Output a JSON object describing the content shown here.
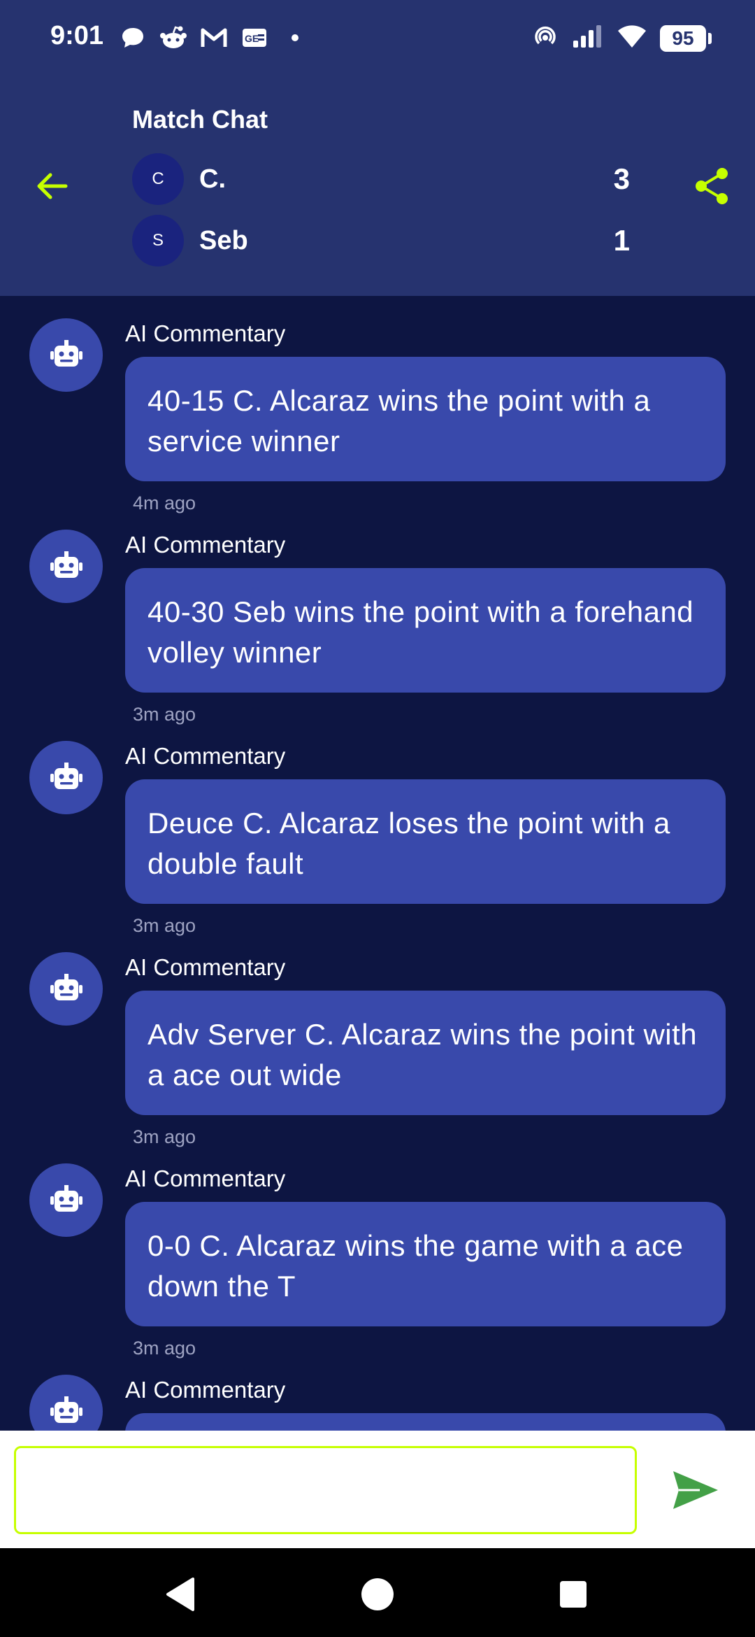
{
  "status_bar": {
    "time": "9:01",
    "battery": "95",
    "notification_icons": [
      "chat-bubble-icon",
      "reddit-icon",
      "gmail-icon",
      "news-icon",
      "dot-icon"
    ],
    "system_icons": [
      "hotspot-icon",
      "signal-icon",
      "wifi-icon",
      "battery-icon"
    ]
  },
  "header": {
    "title": "Match Chat",
    "players": [
      {
        "initial": "C",
        "name": "C.",
        "score": "3"
      },
      {
        "initial": "S",
        "name": "Seb",
        "score": "1"
      }
    ]
  },
  "messages": [
    {
      "sender": "AI Commentary",
      "text": "40-15 C. Alcaraz wins the point with a service winner",
      "time": "4m ago"
    },
    {
      "sender": "AI Commentary",
      "text": "40-30 Seb wins the point with a forehand volley winner",
      "time": "3m ago"
    },
    {
      "sender": "AI Commentary",
      "text": "Deuce C. Alcaraz loses the point with a double fault",
      "time": "3m ago"
    },
    {
      "sender": "AI Commentary",
      "text": "Adv Server C. Alcaraz wins the point with a ace out wide",
      "time": "3m ago"
    },
    {
      "sender": "AI Commentary",
      "text": "0-0 C. Alcaraz wins the game with a ace down the T",
      "time": "3m ago"
    },
    {
      "sender": "AI Commentary",
      "text": "",
      "time": ""
    }
  ],
  "composer": {
    "value": "",
    "placeholder": ""
  },
  "colors": {
    "header_bg": "#26336f",
    "chat_bg": "#0d1542",
    "bubble": "#3949ab",
    "accent_lime": "#c6ff00",
    "send_green": "#43a047"
  }
}
